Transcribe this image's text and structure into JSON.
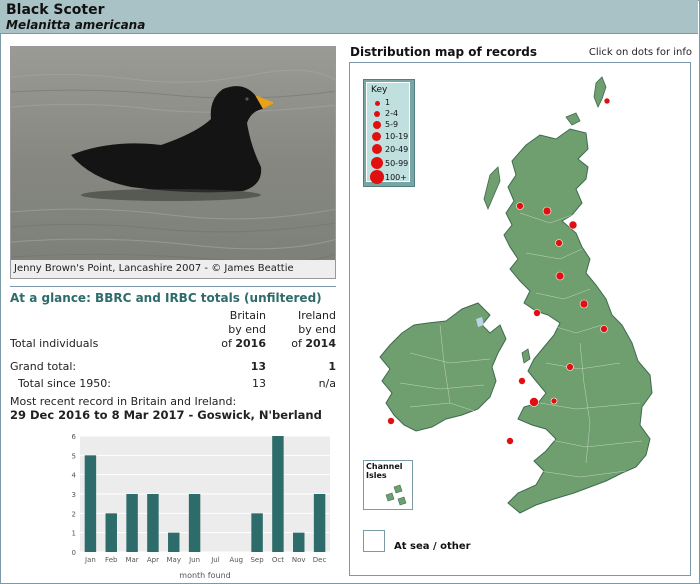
{
  "header": {
    "title": "Black Scoter",
    "subtitle": "Melanitta americana"
  },
  "photo": {
    "caption": "Jenny Brown's Point, Lancashire 2007 - © James Beattie"
  },
  "glance": {
    "title": "At a glance: BBRC and IRBC totals (unfiltered)",
    "col_britain": [
      "Britain",
      "by end",
      "of"
    ],
    "col_britain_year": "2016",
    "col_ireland": [
      "Ireland",
      "by end",
      "of"
    ],
    "col_ireland_year": "2014",
    "row_total_individuals": "Total individuals",
    "row_grand_total": "Grand total:",
    "grand_total_britain": "13",
    "grand_total_ireland": "1",
    "row_since_1950": "Total since 1950:",
    "since_1950_britain": "13",
    "since_1950_ireland": "n/a",
    "recent_label": "Most recent record in Britain and Ireland:",
    "recent_value": "29 Dec 2016 to 8 Mar 2017 - Goswick, N'berland"
  },
  "chart_data": {
    "type": "bar",
    "categories": [
      "Jan",
      "Feb",
      "Mar",
      "Apr",
      "May",
      "Jun",
      "Jul",
      "Aug",
      "Sep",
      "Oct",
      "Nov",
      "Dec"
    ],
    "values": [
      5,
      2,
      3,
      3,
      1,
      3,
      0,
      0,
      2,
      6,
      1,
      3
    ],
    "xlabel": "month found",
    "ylabel": "",
    "ylim": [
      0,
      6
    ],
    "yticks": [
      "0",
      "1",
      "2",
      "3",
      "4",
      "5",
      "6"
    ],
    "bar_color": "#2e6b6b"
  },
  "map": {
    "title": "Distribution map of records",
    "hint": "Click on dots for info",
    "key_title": "Key",
    "key_items": [
      "1",
      "2-4",
      "5-9",
      "10-19",
      "20-49",
      "50-99",
      "100+"
    ],
    "channel_isles_label": [
      "Channel",
      "Isles"
    ],
    "at_sea_label": "At sea / other",
    "land_color": "#6f9e6f",
    "dot_color": "#e01010"
  }
}
